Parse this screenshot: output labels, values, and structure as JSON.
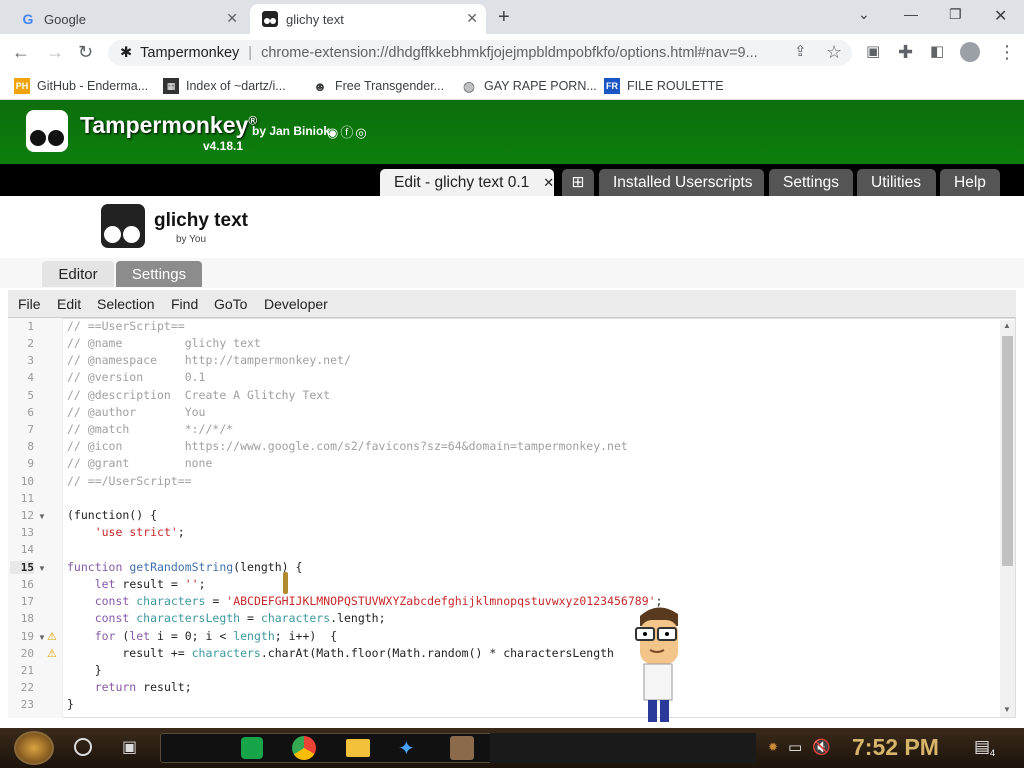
{
  "browser": {
    "tabs": [
      {
        "label": "Google",
        "favicon": "google-icon"
      },
      {
        "label": "glichy text",
        "favicon": "tampermonkey-icon",
        "active": true
      }
    ],
    "address": {
      "site": "Tampermonkey",
      "url": "chrome-extension://dhdgffkkebhmkfjojejmpbldmpobfkfo/options.html#nav=9..."
    },
    "bookmarks": [
      {
        "label": "GitHub - Enderma...",
        "icon": "ph-icon"
      },
      {
        "label": "Index of ~dartz/i...",
        "icon": "index-icon"
      },
      {
        "label": "Free Transgender...",
        "icon": "site-icon"
      },
      {
        "label": "GAY RAPE PORN...",
        "icon": "globe-icon"
      },
      {
        "label": "FILE ROULETTE",
        "icon": "roulette-icon"
      }
    ]
  },
  "tm": {
    "title": "Tampermonkey",
    "reg": "®",
    "by": "by Jan Biniok",
    "version": "v4.18.1",
    "nav": {
      "edit": "Edit - glichy text 0.1",
      "installed": "Installed Userscripts",
      "settings": "Settings",
      "utilities": "Utilities",
      "help": "Help"
    },
    "script": {
      "name": "glichy text",
      "by": "by You"
    },
    "subtabs": {
      "editor": "Editor",
      "settings": "Settings"
    },
    "menu": [
      "File",
      "Edit",
      "Selection",
      "Find",
      "GoTo",
      "Developer"
    ]
  },
  "editor": {
    "lines": [
      "1",
      "2",
      "3",
      "4",
      "5",
      "6",
      "7",
      "8",
      "9",
      "10",
      "11",
      "12",
      "13",
      "14",
      "15",
      "16",
      "17",
      "18",
      "19",
      "20",
      "21",
      "22",
      "23"
    ],
    "code": {
      "l1": "// ==UserScript==",
      "l2": "// @name         glichy text",
      "l3": "// @namespace    http://tampermonkey.net/",
      "l4": "// @version      0.1",
      "l5": "// @description  Create A Glitchy Text",
      "l6": "// @author       You",
      "l7": "// @match        *://*/*",
      "l8": "// @icon         https://www.google.com/s2/favicons?sz=64&domain=tampermonkey.net",
      "l9": "// @grant        none",
      "l10": "// ==/UserScript==",
      "l12": "(function() {",
      "l13a": "    ",
      "l13b": "'use strict'",
      "l13c": ";",
      "l15a": "function ",
      "l15b": "getRandomString",
      "l15c": "(length) {",
      "l16a": "    let ",
      "l16b": "result",
      "l16c": " = ",
      "l16d": "''",
      "l16e": ";",
      "l17a": "    const ",
      "l17b": "characters",
      "l17c": " = ",
      "l17d": "'ABCDEFGHIJKLMNOPQSTUVWXYZabcdefghijklmnopqstuvwxyz0123456789'",
      "l17e": ";",
      "l18a": "    const ",
      "l18b": "charactersLegth",
      "l18c": " = ",
      "l18d": "characters",
      "l18e": ".length;",
      "l19a": "    for ",
      "l19b": "(",
      "l19c": "let ",
      "l19d": "i = 0; i < ",
      "l19e": "length",
      "l19f": "; i++)  {",
      "l20a": "        result += ",
      "l20b": "characters",
      "l20c": ".charAt(Math.floor(Math.random() * charactersLength",
      "l21": "    }",
      "l22a": "    return ",
      "l22b": "result",
      "l22c": ";",
      "l23": "}"
    }
  },
  "taskbar": {
    "clock": "7:52 PM",
    "notifications": "4"
  }
}
